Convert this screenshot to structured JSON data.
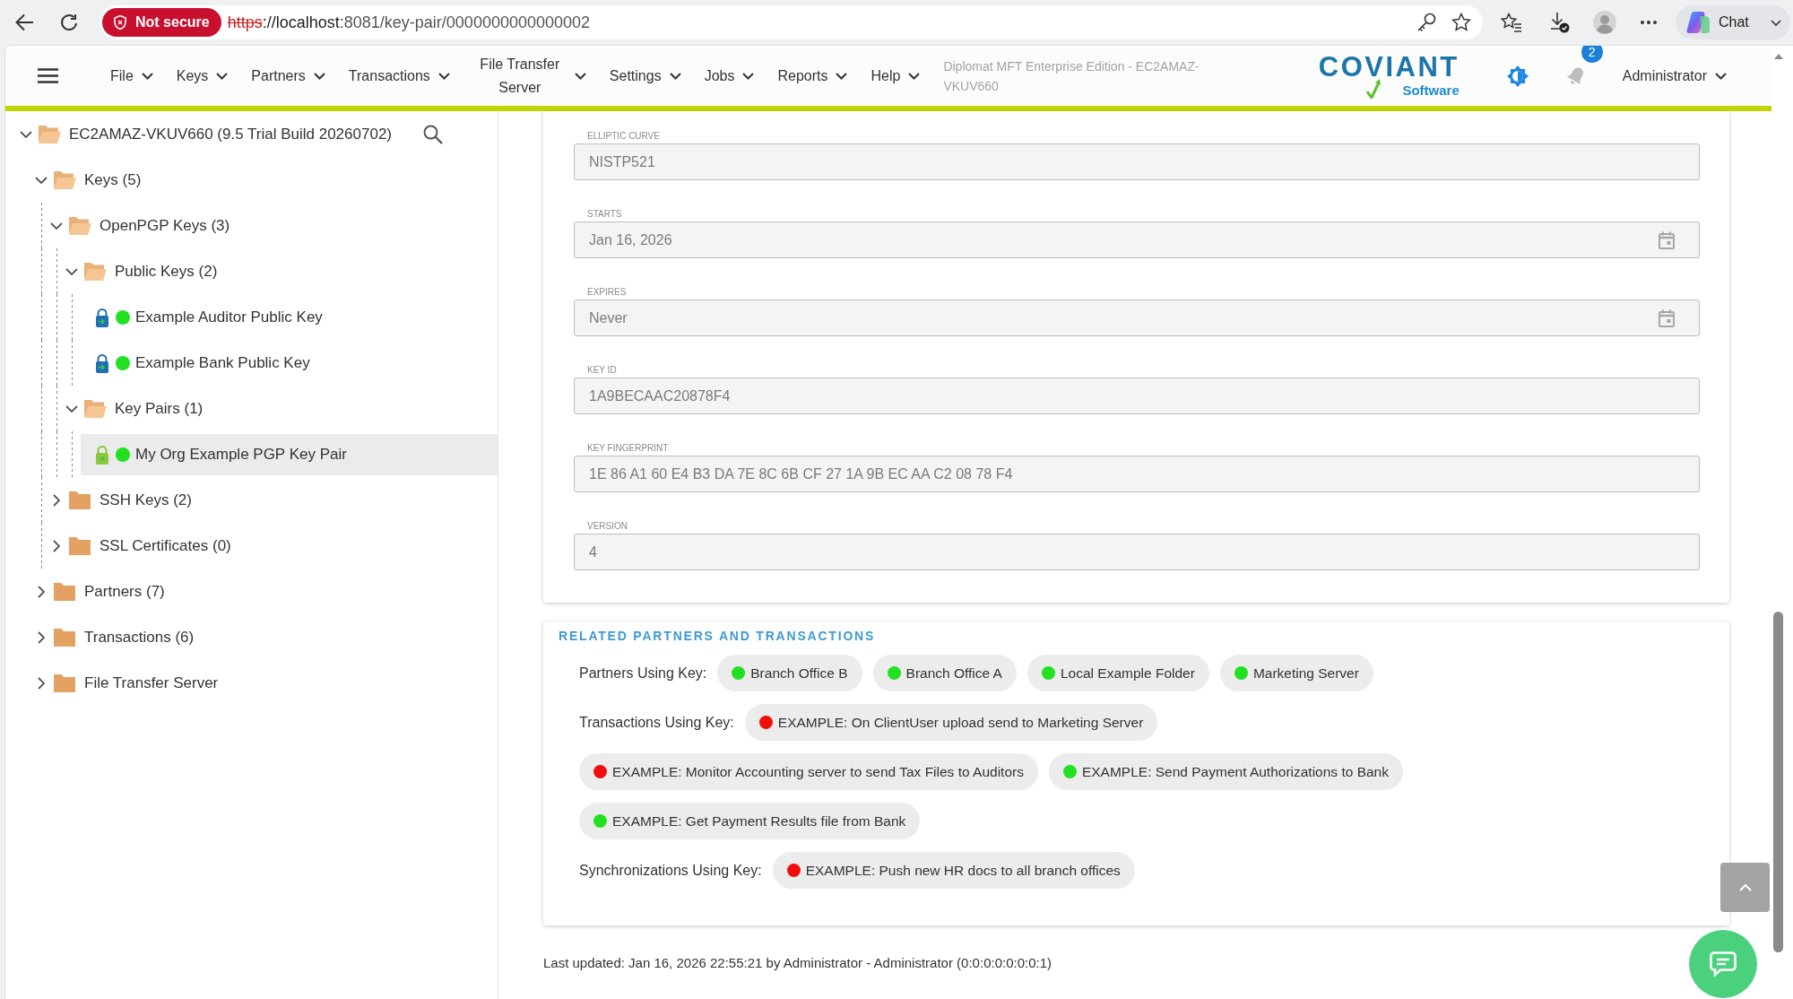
{
  "browser": {
    "security_label": "Not secure",
    "url": {
      "scheme": "https",
      "host": "://localhost",
      "path": ":8081/key-pair/0000000000000002"
    },
    "chat_label": "Chat"
  },
  "header": {
    "menu": [
      "File",
      "Keys",
      "Partners",
      "Transactions",
      "File Transfer Server",
      "Settings",
      "Jobs",
      "Reports",
      "Help"
    ],
    "product_title": "Diplomat MFT Enterprise Edition - EC2AMAZ-VKUV660",
    "logo_text": "COVIANT",
    "logo_subtext": "Software",
    "notification_count": "2",
    "user": "Administrator"
  },
  "tree": [
    {
      "label": "EC2AMAZ-VKUV660 (9.5 Trial Build 20260702)",
      "kind": "folder",
      "expanded": true,
      "selected": false,
      "children": [
        {
          "label": "Keys (5)",
          "kind": "folder",
          "expanded": true,
          "selected": false,
          "children": [
            {
              "label": "OpenPGP Keys (3)",
              "kind": "folder",
              "expanded": true,
              "selected": false,
              "children": [
                {
                  "label": "Public Keys (2)",
                  "kind": "folder",
                  "expanded": true,
                  "selected": false,
                  "children": [
                    {
                      "label": "Example Auditor Public Key",
                      "kind": "public_key",
                      "color": "#22e022",
                      "selected": false
                    },
                    {
                      "label": "Example Bank Public Key",
                      "kind": "public_key",
                      "color": "#22e022",
                      "selected": false
                    }
                  ]
                },
                {
                  "label": "Key Pairs (1)",
                  "kind": "folder",
                  "expanded": true,
                  "selected": false,
                  "children": [
                    {
                      "label": "My Org Example PGP Key Pair",
                      "kind": "key_pair",
                      "color": "#22e022",
                      "selected": true
                    }
                  ]
                }
              ]
            },
            {
              "label": "SSH Keys (2)",
              "kind": "folder",
              "expanded": false,
              "selected": false
            },
            {
              "label": "SSL Certificates (0)",
              "kind": "folder",
              "expanded": false,
              "selected": false
            }
          ]
        },
        {
          "label": "Partners (7)",
          "kind": "folder",
          "expanded": false,
          "selected": false
        },
        {
          "label": "Transactions (6)",
          "kind": "folder",
          "expanded": false,
          "selected": false
        },
        {
          "label": "File Transfer Server",
          "kind": "folder",
          "expanded": false,
          "selected": false
        }
      ]
    }
  ],
  "key_details": {
    "fields": [
      {
        "label": "ELLIPTIC CURVE",
        "value": "NISTP521",
        "kind": "text"
      },
      {
        "label": "STARTS",
        "value": "Jan 16, 2026",
        "kind": "date"
      },
      {
        "label": "EXPIRES",
        "value": "Never",
        "kind": "date"
      },
      {
        "label": "KEY ID",
        "value": "1A9BECAAC20878F4",
        "kind": "text"
      },
      {
        "label": "KEY FINGERPRINT",
        "value": "1E 86 A1 60 E4 B3 DA 7E 8C 6B CF 27 1A 9B EC AA C2 08 78 F4",
        "kind": "text"
      },
      {
        "label": "VERSION",
        "value": "4",
        "kind": "text"
      }
    ]
  },
  "related": {
    "title": "RELATED PARTNERS AND TRANSACTIONS",
    "groups": [
      {
        "label": "Partners Using Key:",
        "items": [
          {
            "label": "Branch Office B",
            "color": "#22e022"
          },
          {
            "label": "Branch Office A",
            "color": "#22e022"
          },
          {
            "label": "Local Example Folder",
            "color": "#22e022"
          },
          {
            "label": "Marketing Server",
            "color": "#22e022"
          }
        ]
      },
      {
        "label": "Transactions Using Key:",
        "items": [
          {
            "label": "EXAMPLE: On ClientUser upload send to Marketing Server",
            "color": "#f20d0d"
          },
          {
            "label": "EXAMPLE: Monitor Accounting server to send Tax Files to Auditors",
            "color": "#f20d0d"
          },
          {
            "label": "EXAMPLE: Send Payment Authorizations to Bank",
            "color": "#22e022"
          },
          {
            "label": "EXAMPLE: Get Payment Results file from Bank",
            "color": "#22e022"
          }
        ]
      },
      {
        "label": "Synchronizations Using Key:",
        "items": [
          {
            "label": "EXAMPLE: Push new HR docs to all branch offices",
            "color": "#f20d0d"
          }
        ]
      }
    ]
  },
  "footer": {
    "last_updated": "Last updated: Jan 16, 2026 22:55:21 by Administrator - Administrator (0:0:0:0:0:0:0:1)"
  }
}
